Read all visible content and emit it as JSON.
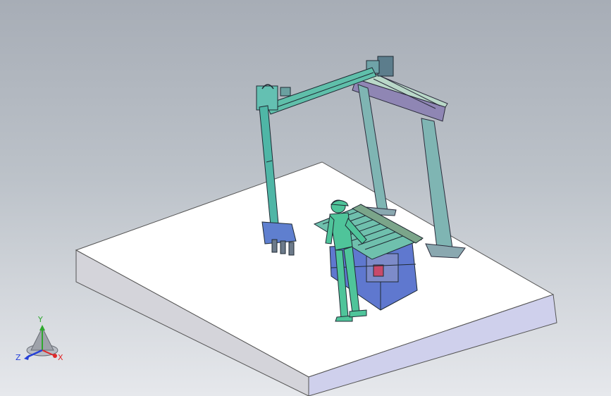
{
  "viewport": {
    "background_top": "#a7adb6",
    "background_bottom": "#e6e8ec"
  },
  "model": {
    "base_plate_color": "#ffffff",
    "frame_color": "#7fb5b3",
    "beam_color": "#5fbfaa",
    "rail_color": "#8f86b4",
    "conveyor_color": "#6fc0ad",
    "table_color": "#5f78cf",
    "operator_color": "#4fc49a"
  },
  "triad": {
    "x_label": "X",
    "y_label": "Y",
    "z_label": "Z",
    "x_color": "#e0282a",
    "y_color": "#2fa82f",
    "z_color": "#2540d8"
  }
}
